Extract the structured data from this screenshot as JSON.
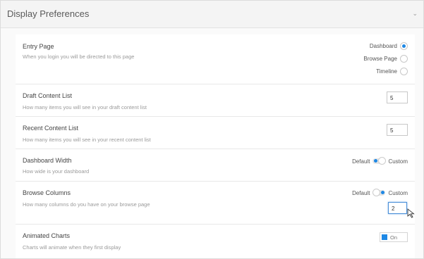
{
  "panel": {
    "title": "Display Preferences"
  },
  "entry_page": {
    "label": "Entry Page",
    "description": "When you login you will be directed to this page",
    "options": [
      "Dashboard",
      "Browse Page",
      "Timeline"
    ],
    "selected": "Dashboard"
  },
  "draft_content": {
    "label": "Draft Content List",
    "description": "How many items you will see in your draft content list",
    "value": "5"
  },
  "recent_content": {
    "label": "Recent Content List",
    "description": "How many items you will see in your recent content list",
    "value": "5"
  },
  "dashboard_width": {
    "label": "Dashboard Width",
    "description": "How wide is your dashboard",
    "left_option": "Default",
    "right_option": "Custom",
    "selected": "Default"
  },
  "browse_columns": {
    "label": "Browse Columns",
    "description": "How many columns do you have on your browse page",
    "left_option": "Default",
    "right_option": "Custom",
    "selected": "Custom",
    "value": "2"
  },
  "animated_charts": {
    "label": "Animated Charts",
    "description": "Charts will animate when they first display",
    "toggle_label": "On"
  },
  "accent_color": "#1e88e5"
}
